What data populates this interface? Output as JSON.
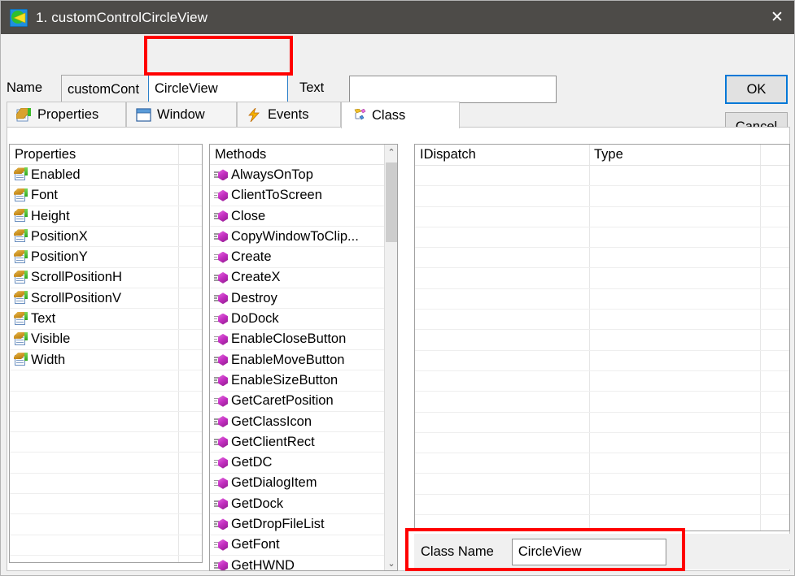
{
  "window": {
    "title": "1. customControlCircleView",
    "icon": "app-circleview-icon",
    "close_label": "✕",
    "titlebar_color": "#4d4b48"
  },
  "header": {
    "name_label": "Name",
    "name_background_value": "customCont",
    "name_value": "CircleView",
    "name_placeholder": "",
    "text_label": "Text",
    "text_value": "",
    "text_placeholder": "",
    "ok_label": "OK",
    "cancel_label": "Cancel",
    "focus_color": "#0078d7"
  },
  "tabs": [
    {
      "label": "Properties",
      "icon": "properties-tab-icon",
      "active": false
    },
    {
      "label": "Window",
      "icon": "window-tab-icon",
      "active": false
    },
    {
      "label": "Events",
      "icon": "events-tab-icon",
      "active": false
    },
    {
      "label": "Class",
      "icon": "class-tab-icon",
      "active": true
    }
  ],
  "properties_grid": {
    "header": "Properties",
    "items": [
      "Enabled",
      "Font",
      "Height",
      "PositionX",
      "PositionY",
      "ScrollPositionH",
      "ScrollPositionV",
      "Text",
      "Visible",
      "Width"
    ],
    "empty_rows": 10
  },
  "methods_grid": {
    "header": "Methods",
    "items": [
      "AlwaysOnTop",
      "ClientToScreen",
      "Close",
      "CopyWindowToClip...",
      "Create",
      "CreateX",
      "Destroy",
      "DoDock",
      "EnableCloseButton",
      "EnableMoveButton",
      "EnableSizeButton",
      "GetCaretPosition",
      "GetClassIcon",
      "GetClientRect",
      "GetDC",
      "GetDialogItem",
      "GetDock",
      "GetDropFileList",
      "GetFont",
      "GetHWND"
    ],
    "scroll_up_label": "⌃",
    "scroll_down_label": "⌄"
  },
  "dispatch_grid": {
    "col_idispatch": "IDispatch",
    "col_type": "Type",
    "rows": [],
    "empty_rows": 18
  },
  "class_name": {
    "label": "Class Name",
    "value": "CircleView",
    "placeholder": ""
  },
  "annotations": {
    "highlight_color": "#ff0000",
    "boxes": [
      "name-field-highlight",
      "class-name-highlight"
    ]
  }
}
